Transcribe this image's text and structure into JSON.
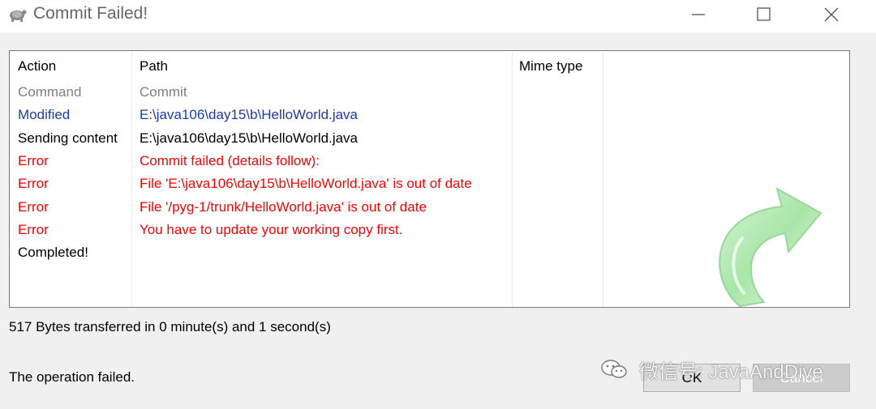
{
  "window": {
    "title": "Commit Failed!",
    "controls": [
      "minimize",
      "maximize",
      "close"
    ]
  },
  "log": {
    "headers": {
      "action": "Action",
      "path": "Path",
      "mime": "Mime type"
    },
    "rows": [
      {
        "action": "Command",
        "path": "Commit",
        "color": "#7f7f7f"
      },
      {
        "action": "Modified",
        "path": "E:\\java106\\day15\\b\\HelloWorld.java",
        "color": "#1c3aa9"
      },
      {
        "action": "Sending content",
        "path": "E:\\java106\\day15\\b\\HelloWorld.java",
        "color": "#000000"
      },
      {
        "action": "Error",
        "path": "Commit failed (details follow):",
        "color": "#ff0000"
      },
      {
        "action": "Error",
        "path": "File 'E:\\java106\\day15\\b\\HelloWorld.java' is out of date",
        "color": "#ff0000"
      },
      {
        "action": "Error",
        "path": "File '/pyg-1/trunk/HelloWorld.java' is out of date",
        "color": "#ff0000"
      },
      {
        "action": "Error",
        "path": "You have to update your working copy first.",
        "color": "#ff0000"
      },
      {
        "action": "Completed!",
        "path": "",
        "color": "#000000"
      }
    ]
  },
  "footer": {
    "transfer_info": "517 Bytes transferred in 0 minute(s) and 1 second(s)",
    "status": "The operation failed.",
    "ok_label": "OK",
    "cancel_label": "Cancel"
  },
  "watermark": {
    "text": "微信号: JavaAndDive",
    "icon": "wechat-icon"
  },
  "colors": {
    "error": "#ff0000",
    "modified": "#1c3aa9",
    "command": "#7f7f7f",
    "arrow": "#9be09b"
  }
}
